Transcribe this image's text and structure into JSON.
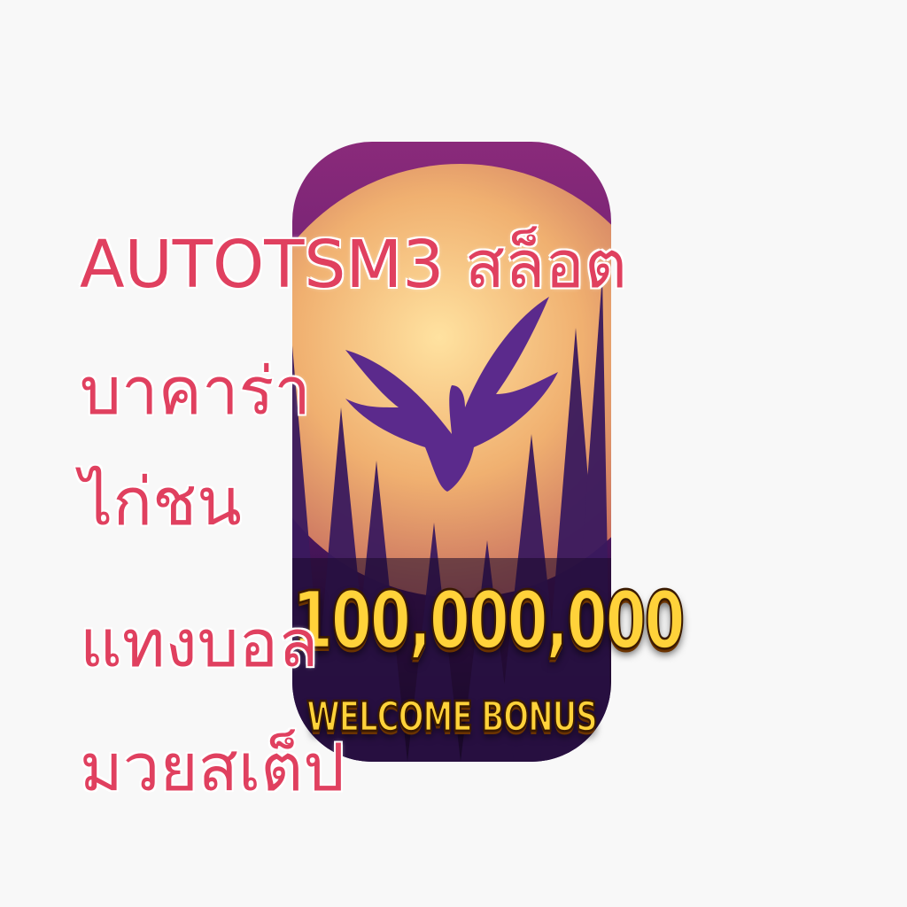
{
  "overlay_lines": [
    "AUTOTSM3 สล็อต",
    "บาคาร่า",
    "ไก่ชน",
    "แทงบอล",
    "มวยสเต็ป"
  ],
  "banner": {
    "amount": "100,000,000",
    "label": "WELCOME BONUS"
  },
  "colors": {
    "overlay_text": "#e0405f",
    "bonus_text": "#ffd23a",
    "sky": "#5a1a6e",
    "moon": "#f0b070",
    "eagle": "#5b2a8c",
    "trees": "#3a1a5e"
  },
  "icons": [
    "eagle-silhouette-icon",
    "full-moon-icon",
    "pine-trees-icon"
  ]
}
